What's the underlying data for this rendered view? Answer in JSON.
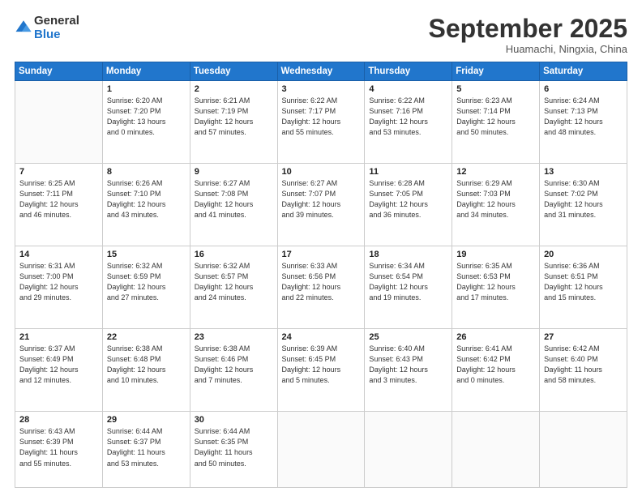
{
  "header": {
    "logo_general": "General",
    "logo_blue": "Blue",
    "month": "September 2025",
    "location": "Huamachi, Ningxia, China"
  },
  "days_of_week": [
    "Sunday",
    "Monday",
    "Tuesday",
    "Wednesday",
    "Thursday",
    "Friday",
    "Saturday"
  ],
  "weeks": [
    [
      {
        "num": "",
        "info": ""
      },
      {
        "num": "1",
        "info": "Sunrise: 6:20 AM\nSunset: 7:20 PM\nDaylight: 13 hours\nand 0 minutes."
      },
      {
        "num": "2",
        "info": "Sunrise: 6:21 AM\nSunset: 7:19 PM\nDaylight: 12 hours\nand 57 minutes."
      },
      {
        "num": "3",
        "info": "Sunrise: 6:22 AM\nSunset: 7:17 PM\nDaylight: 12 hours\nand 55 minutes."
      },
      {
        "num": "4",
        "info": "Sunrise: 6:22 AM\nSunset: 7:16 PM\nDaylight: 12 hours\nand 53 minutes."
      },
      {
        "num": "5",
        "info": "Sunrise: 6:23 AM\nSunset: 7:14 PM\nDaylight: 12 hours\nand 50 minutes."
      },
      {
        "num": "6",
        "info": "Sunrise: 6:24 AM\nSunset: 7:13 PM\nDaylight: 12 hours\nand 48 minutes."
      }
    ],
    [
      {
        "num": "7",
        "info": "Sunrise: 6:25 AM\nSunset: 7:11 PM\nDaylight: 12 hours\nand 46 minutes."
      },
      {
        "num": "8",
        "info": "Sunrise: 6:26 AM\nSunset: 7:10 PM\nDaylight: 12 hours\nand 43 minutes."
      },
      {
        "num": "9",
        "info": "Sunrise: 6:27 AM\nSunset: 7:08 PM\nDaylight: 12 hours\nand 41 minutes."
      },
      {
        "num": "10",
        "info": "Sunrise: 6:27 AM\nSunset: 7:07 PM\nDaylight: 12 hours\nand 39 minutes."
      },
      {
        "num": "11",
        "info": "Sunrise: 6:28 AM\nSunset: 7:05 PM\nDaylight: 12 hours\nand 36 minutes."
      },
      {
        "num": "12",
        "info": "Sunrise: 6:29 AM\nSunset: 7:03 PM\nDaylight: 12 hours\nand 34 minutes."
      },
      {
        "num": "13",
        "info": "Sunrise: 6:30 AM\nSunset: 7:02 PM\nDaylight: 12 hours\nand 31 minutes."
      }
    ],
    [
      {
        "num": "14",
        "info": "Sunrise: 6:31 AM\nSunset: 7:00 PM\nDaylight: 12 hours\nand 29 minutes."
      },
      {
        "num": "15",
        "info": "Sunrise: 6:32 AM\nSunset: 6:59 PM\nDaylight: 12 hours\nand 27 minutes."
      },
      {
        "num": "16",
        "info": "Sunrise: 6:32 AM\nSunset: 6:57 PM\nDaylight: 12 hours\nand 24 minutes."
      },
      {
        "num": "17",
        "info": "Sunrise: 6:33 AM\nSunset: 6:56 PM\nDaylight: 12 hours\nand 22 minutes."
      },
      {
        "num": "18",
        "info": "Sunrise: 6:34 AM\nSunset: 6:54 PM\nDaylight: 12 hours\nand 19 minutes."
      },
      {
        "num": "19",
        "info": "Sunrise: 6:35 AM\nSunset: 6:53 PM\nDaylight: 12 hours\nand 17 minutes."
      },
      {
        "num": "20",
        "info": "Sunrise: 6:36 AM\nSunset: 6:51 PM\nDaylight: 12 hours\nand 15 minutes."
      }
    ],
    [
      {
        "num": "21",
        "info": "Sunrise: 6:37 AM\nSunset: 6:49 PM\nDaylight: 12 hours\nand 12 minutes."
      },
      {
        "num": "22",
        "info": "Sunrise: 6:38 AM\nSunset: 6:48 PM\nDaylight: 12 hours\nand 10 minutes."
      },
      {
        "num": "23",
        "info": "Sunrise: 6:38 AM\nSunset: 6:46 PM\nDaylight: 12 hours\nand 7 minutes."
      },
      {
        "num": "24",
        "info": "Sunrise: 6:39 AM\nSunset: 6:45 PM\nDaylight: 12 hours\nand 5 minutes."
      },
      {
        "num": "25",
        "info": "Sunrise: 6:40 AM\nSunset: 6:43 PM\nDaylight: 12 hours\nand 3 minutes."
      },
      {
        "num": "26",
        "info": "Sunrise: 6:41 AM\nSunset: 6:42 PM\nDaylight: 12 hours\nand 0 minutes."
      },
      {
        "num": "27",
        "info": "Sunrise: 6:42 AM\nSunset: 6:40 PM\nDaylight: 11 hours\nand 58 minutes."
      }
    ],
    [
      {
        "num": "28",
        "info": "Sunrise: 6:43 AM\nSunset: 6:39 PM\nDaylight: 11 hours\nand 55 minutes."
      },
      {
        "num": "29",
        "info": "Sunrise: 6:44 AM\nSunset: 6:37 PM\nDaylight: 11 hours\nand 53 minutes."
      },
      {
        "num": "30",
        "info": "Sunrise: 6:44 AM\nSunset: 6:35 PM\nDaylight: 11 hours\nand 50 minutes."
      },
      {
        "num": "",
        "info": ""
      },
      {
        "num": "",
        "info": ""
      },
      {
        "num": "",
        "info": ""
      },
      {
        "num": "",
        "info": ""
      }
    ]
  ]
}
